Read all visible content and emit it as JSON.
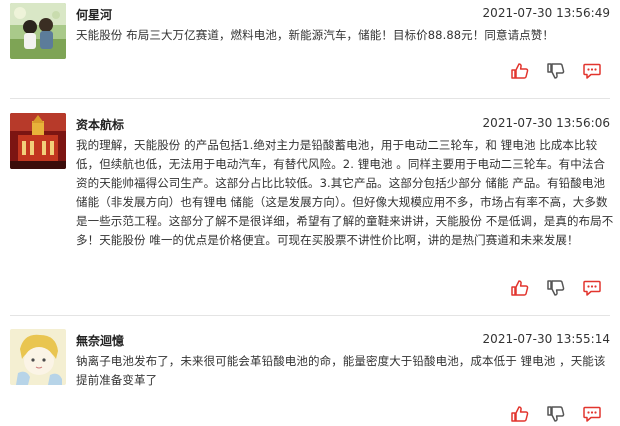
{
  "comments": [
    {
      "user": "何星河",
      "time": "2021-07-30 13:56:49",
      "text": "天能股份 布局三大万亿赛道，燃料电池，新能源汽车，储能！目标价88.88元！同意请点赞！"
    },
    {
      "user": "资本航标",
      "time": "2021-07-30 13:56:06",
      "text": "我的理解，天能股份 的产品包括1.绝对主力是铅酸蓄电池，用于电动二三轮车，和 锂电池 比成本比较低，但续航也低，无法用于电动汽车，有替代风险。2. 锂电池 。同样主要用于电动二三轮车。有中法合资的天能帅福得公司生产。这部分占比比较低。3.其它产品。这部分包括少部分 储能 产品。有铅酸电池 储能（非发展方向）也有锂电 储能（这是发展方向）。但好像大规模应用不多，市场占有率不高，大多数是一些示范工程。这部分了解不是很详细，希望有了解的童鞋来讲讲，天能股份 不是低调，是真的布局不多！天能股份 唯一的优点是价格便宜。可现在买股票不讲性价比啊，讲的是热门赛道和未来发展！"
    },
    {
      "user": "無奈迴憶",
      "time": "2021-07-30 13:55:14",
      "text": "钠离子电池发布了，未来很可能会革铅酸电池的命，能量密度大于铅酸电池，成本低于 锂电池 ，天能该提前准备变革了"
    }
  ],
  "colors": {
    "accent": "#e2352e",
    "gray_icon": "#555555",
    "separator": "#e4e4e4"
  },
  "icons": [
    "thumbs-up-icon",
    "thumbs-down-icon",
    "reply-icon"
  ]
}
